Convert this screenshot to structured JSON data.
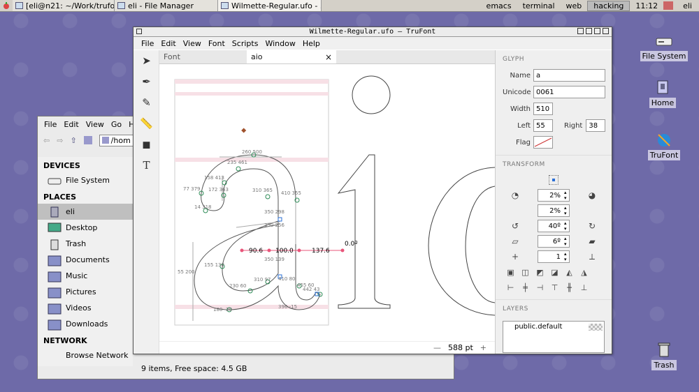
{
  "top_panel": {
    "tasks": [
      {
        "label": "[eli@n21: ~/Work/trufo..."
      },
      {
        "label": "eli - File Manager"
      },
      {
        "label": "Wilmette-Regular.ufo - ..."
      }
    ],
    "launchers": [
      "emacs",
      "terminal",
      "web",
      "hacking"
    ],
    "clock": "11:12",
    "user": "eli"
  },
  "desktop_icons": {
    "filesystem": "File System",
    "home": "Home",
    "trufont": "TruFont",
    "trash": "Trash"
  },
  "file_manager": {
    "menu": [
      "File",
      "Edit",
      "View",
      "Go",
      "H"
    ],
    "location": "/hom",
    "sidebar": {
      "devices_header": "DEVICES",
      "filesystem": "File System",
      "places_header": "PLACES",
      "places": [
        "eli",
        "Desktop",
        "Trash",
        "Documents",
        "Music",
        "Pictures",
        "Videos",
        "Downloads"
      ],
      "network_header": "NETWORK",
      "browse_network": "Browse Network"
    },
    "status": "9 items, Free space: 4.5 GB"
  },
  "trufont": {
    "title": "Wilmette-Regular.ufo – TruFont",
    "menu": [
      "File",
      "Edit",
      "View",
      "Font",
      "Scripts",
      "Window",
      "Help"
    ],
    "tabs": [
      "Font",
      "aio"
    ],
    "tab_close": "×",
    "zoom": "588 pt",
    "zoom_minus": "—",
    "zoom_plus": "+",
    "canvas": {
      "glyph_text": "io",
      "measure": {
        "left": "90.6",
        "mid": "100.0",
        "right": "137.6",
        "angle": "0.0º"
      },
      "points": [
        "260 500",
        "235 461",
        "158 413",
        "77 379",
        "172 363",
        "310 365",
        "410 355",
        "14 318",
        "350 298",
        "350 256",
        "55 200",
        "155 130",
        "350 139",
        "230 60",
        "310 97",
        "410 80",
        "455 60",
        "442 43",
        "180 -20",
        "396 -15"
      ]
    },
    "inspector": {
      "glyph_header": "GLYPH",
      "name_label": "Name",
      "name_value": "a",
      "unicode_label": "Unicode",
      "unicode_value": "0061",
      "width_label": "Width",
      "width_value": "510",
      "left_label": "Left",
      "left_value": "55",
      "right_label": "Right",
      "right_value": "38",
      "flag_label": "Flag",
      "transform_header": "TRANSFORM",
      "scale1": "2%",
      "scale2": "2%",
      "rotate": "40º",
      "skew": "6º",
      "snap": "1",
      "layers_header": "LAYERS",
      "layer_name": "public.default"
    }
  }
}
